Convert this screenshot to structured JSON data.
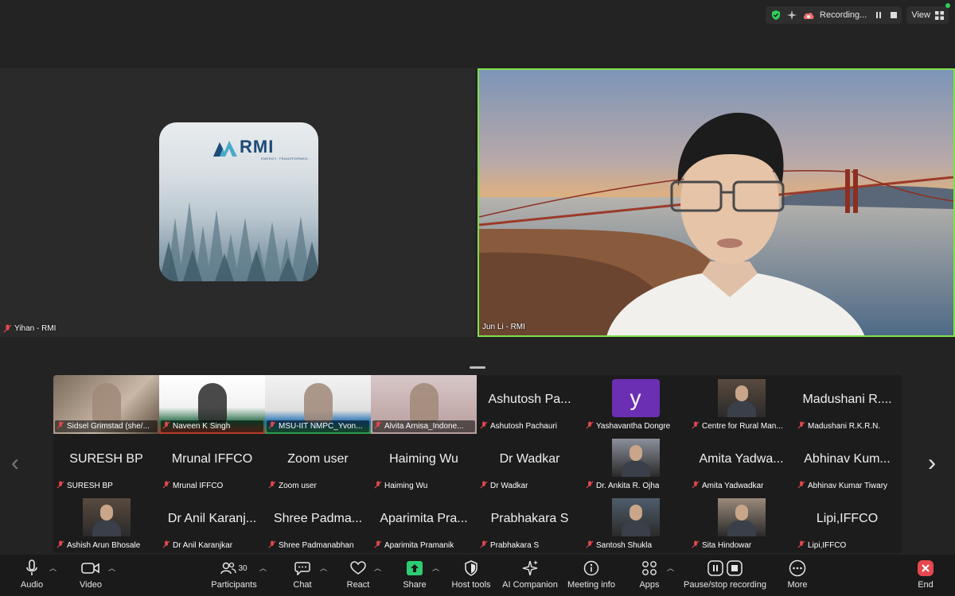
{
  "topbar": {
    "recording_label": "Recording...",
    "view_label": "View",
    "icons": [
      "shield-check-icon",
      "sparkle-icon",
      "cloud-record-icon",
      "pause-icon",
      "stop-icon",
      "grid-view-icon"
    ]
  },
  "main_tiles": {
    "left": {
      "name": "Yihan - RMI",
      "logo_text": "RMI",
      "logo_tagline": "ENERGY. TRANSFORMED."
    },
    "right": {
      "name": "Jun Li - RMI"
    }
  },
  "grid": {
    "rows": [
      [
        {
          "type": "video",
          "name": "Sidsel Grimstad (she/..."
        },
        {
          "type": "video",
          "name": "Naveen K Singh"
        },
        {
          "type": "video",
          "name": "MSU-IIT NMPC_Yvon..."
        },
        {
          "type": "video",
          "name": "Alvita Arnisa_Indone..."
        },
        {
          "type": "text",
          "display": "Ashutosh Pa...",
          "name": "Ashutosh Pachauri"
        },
        {
          "type": "avatar",
          "letter": "y",
          "name": "Yashavantha Dongre"
        },
        {
          "type": "photo",
          "name": "Centre for Rural Man..."
        },
        {
          "type": "text",
          "display": "Madushani R....",
          "name": "Madushani R.K.R.N."
        }
      ],
      [
        {
          "type": "text",
          "display": "SURESH BP",
          "name": "SURESH BP"
        },
        {
          "type": "text",
          "display": "Mrunal IFFCO",
          "name": "Mrunal IFFCO"
        },
        {
          "type": "text",
          "display": "Zoom user",
          "name": "Zoom user"
        },
        {
          "type": "text",
          "display": "Haiming Wu",
          "name": "Haiming Wu"
        },
        {
          "type": "text",
          "display": "Dr Wadkar",
          "name": "Dr Wadkar"
        },
        {
          "type": "photo",
          "name": "Dr. Ankita R. Ojha"
        },
        {
          "type": "text",
          "display": "Amita Yadwa...",
          "name": "Amita Yadwadkar"
        },
        {
          "type": "text",
          "display": "Abhinav Kum...",
          "name": "Abhinav Kumar Tiwary"
        }
      ],
      [
        {
          "type": "photo",
          "name": "Ashish Arun Bhosale"
        },
        {
          "type": "text",
          "display": "Dr Anil Karanj...",
          "name": "Dr Anil Karanjkar"
        },
        {
          "type": "text",
          "display": "Shree Padma...",
          "name": "Shree Padmanabhan"
        },
        {
          "type": "text",
          "display": "Aparimita Pra...",
          "name": "Aparimita Pramanik"
        },
        {
          "type": "text",
          "display": "Prabhakara S",
          "name": "Prabhakara S"
        },
        {
          "type": "photo",
          "name": "Santosh Shukla"
        },
        {
          "type": "photo",
          "name": "Sita Hindowar"
        },
        {
          "type": "text",
          "display": "Lipi,IFFCO",
          "name": "Lipi,IFFCO"
        }
      ]
    ]
  },
  "toolbar": {
    "audio": "Audio",
    "video": "Video",
    "participants": "Participants",
    "participants_count": "30",
    "chat": "Chat",
    "react": "React",
    "share": "Share",
    "host_tools": "Host tools",
    "ai_companion": "AI Companion",
    "meeting_info": "Meeting info",
    "apps": "Apps",
    "pause_stop_recording": "Pause/stop recording",
    "more": "More",
    "end": "End"
  },
  "colors": {
    "active_speaker_border": "#7ee14a",
    "share_green": "#2ecc71",
    "end_red": "#e5484d",
    "avatar_purple": "#6b2fb3"
  }
}
